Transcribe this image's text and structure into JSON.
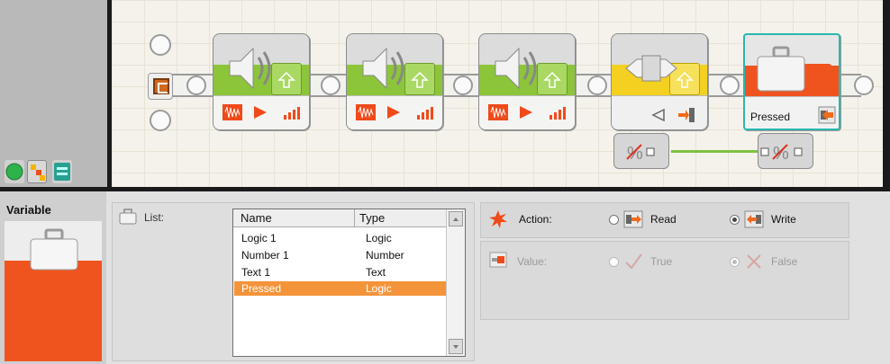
{
  "palette": {
    "tabs": [
      {
        "name": "common-palette",
        "icon": "green-circle-icon"
      },
      {
        "name": "complete-palette",
        "icon": "squares-icon"
      },
      {
        "name": "custom-palette",
        "icon": "stack-icon"
      }
    ]
  },
  "program": {
    "blocks": [
      {
        "type": "sound",
        "icon": "speaker-icon",
        "controls": [
          "waveform-icon",
          "play-icon",
          "volume-icon"
        ]
      },
      {
        "type": "sound",
        "icon": "speaker-icon",
        "controls": [
          "waveform-icon",
          "play-icon",
          "volume-icon"
        ]
      },
      {
        "type": "sound",
        "icon": "speaker-icon",
        "controls": [
          "waveform-icon",
          "play-icon",
          "volume-icon"
        ]
      },
      {
        "type": "data",
        "icon": "data-icon",
        "controls": [
          "arrow-left-icon",
          "plug-in-icon"
        ]
      },
      {
        "type": "variable",
        "icon": "suitcase-icon",
        "label": "Pressed",
        "controls": [
          "write-icon"
        ]
      }
    ],
    "colors": {
      "sound_green": "#8cc53a",
      "data_yellow": "#f4d020",
      "variable_orange": "#f0541e",
      "selection_teal": "#29b7b0",
      "wire_green": "#7dc242"
    }
  },
  "config": {
    "title": "Variable",
    "list_label": "List:",
    "columns": [
      "Name",
      "Type"
    ],
    "rows": [
      {
        "name": "Logic 1",
        "type": "Logic"
      },
      {
        "name": "Number 1",
        "type": "Number"
      },
      {
        "name": "Text 1",
        "type": "Text"
      },
      {
        "name": "Pressed",
        "type": "Logic",
        "selected": true
      }
    ],
    "action": {
      "label": "Action:",
      "options": [
        {
          "label": "Read",
          "checked": false
        },
        {
          "label": "Write",
          "checked": true
        }
      ]
    },
    "value": {
      "label": "Value:",
      "options": [
        {
          "label": "True",
          "checked": false
        },
        {
          "label": "False",
          "checked": true
        }
      ],
      "enabled": false
    },
    "colors": {
      "row_selected": "#f4943a"
    }
  }
}
